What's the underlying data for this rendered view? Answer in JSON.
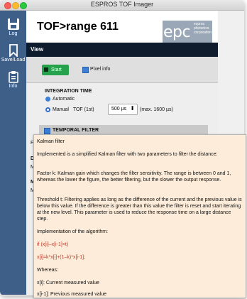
{
  "window": {
    "title": "ESPROS TOF Imager"
  },
  "sidebar": {
    "items": [
      {
        "label": "Log",
        "icon": "save-disk-icon"
      },
      {
        "label": "Save/Load",
        "icon": "bookmark-icon"
      },
      {
        "label": "Info",
        "icon": "clipboard-icon"
      }
    ]
  },
  "header": {
    "title": "TOF>range 611",
    "logo_main": "epc",
    "logo_sub": [
      "espros",
      "photonics",
      "corporation"
    ]
  },
  "view": {
    "label": "View"
  },
  "controls": {
    "start_label": "Start",
    "pixel_info_label": "Pixel info"
  },
  "integration": {
    "title": "INTEGRATION TIME",
    "automatic_label": "Automatic",
    "manual_label": "Manual",
    "tof_label": "TOF (1st)",
    "selected_value": "500 µs",
    "max_label": "(max. 1600 µs)"
  },
  "temporal": {
    "title": "TEMPORAL FILTER",
    "fragments": [
      "Fa",
      "Di",
      "Mi",
      "Mi",
      "M"
    ]
  },
  "tooltip": {
    "title": "Kalman filter",
    "intro": "Implemented is a simplified Kalman filter with two parameters to filter the distance:",
    "factor_k": "Factor k: Kalman gain which changes the filter sensitivity. The range is between 0 and 1, whereas the lower the figure, the better filtering, but the slower the output response.",
    "threshold": "Threshold t: Filtering applies as long as the difference of the current and the previous value is below this value. If the difference is greater than this value the filter is reset and start iterating at the new level. This parameter is used to reduce the response time on a large distance step.",
    "impl_heading": "Implementation of the algorithm:",
    "code_if": "if (x[i]–x[i-1]<t)",
    "code_eq": "x[i]=k*x[i]+(1–k)*x[i-1];",
    "whereas": "Whereas:",
    "def_current": "x[i]: Current measured value",
    "def_previous": "x[i-1]: Previous measured value"
  },
  "colors": {
    "sidebar": "#3e5f88",
    "view_bar": "#0f1c2e",
    "start_button": "#27a24c",
    "checkbox": "#3b7fd9",
    "tooltip_bg": "#fdecd9",
    "code_text": "#c0392b",
    "logo_box": "#9aa7b6"
  }
}
